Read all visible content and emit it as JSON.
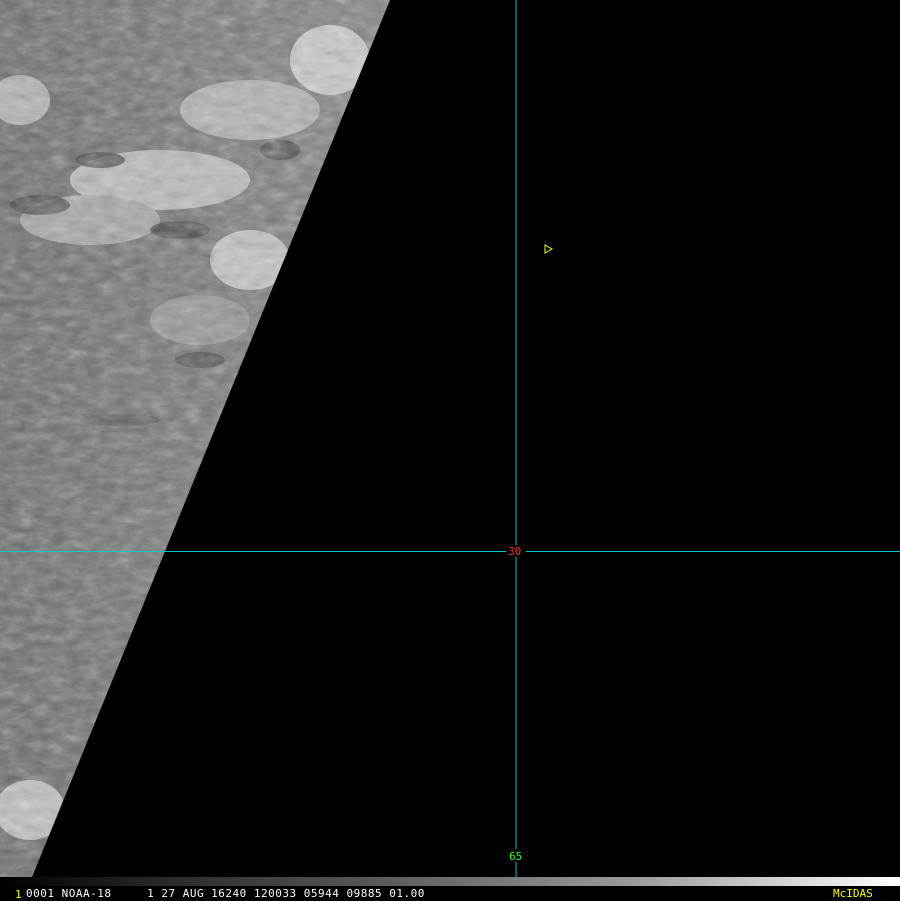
{
  "image": {
    "type": "satellite-imagery",
    "channel_look": "grayscale",
    "satellite": "NOAA-18",
    "colors": {
      "background": "#000000",
      "grid_line": "#00c8c8",
      "lat_label": "#ff2a2a",
      "lon_label": "#33ff33",
      "cursor": "#ffff00",
      "status_text": "#ffffff",
      "brand_text": "#ffff00"
    }
  },
  "grid": {
    "latitude_label": "30",
    "longitude_label": "65"
  },
  "cursor": {
    "icon": "triangle-cursor-icon"
  },
  "status_bar": {
    "frame_number": "1",
    "text": "0001 NOAA-18     1 27 AUG 16240 120033 05944 09885 01.00",
    "brand": "McIDAS"
  }
}
